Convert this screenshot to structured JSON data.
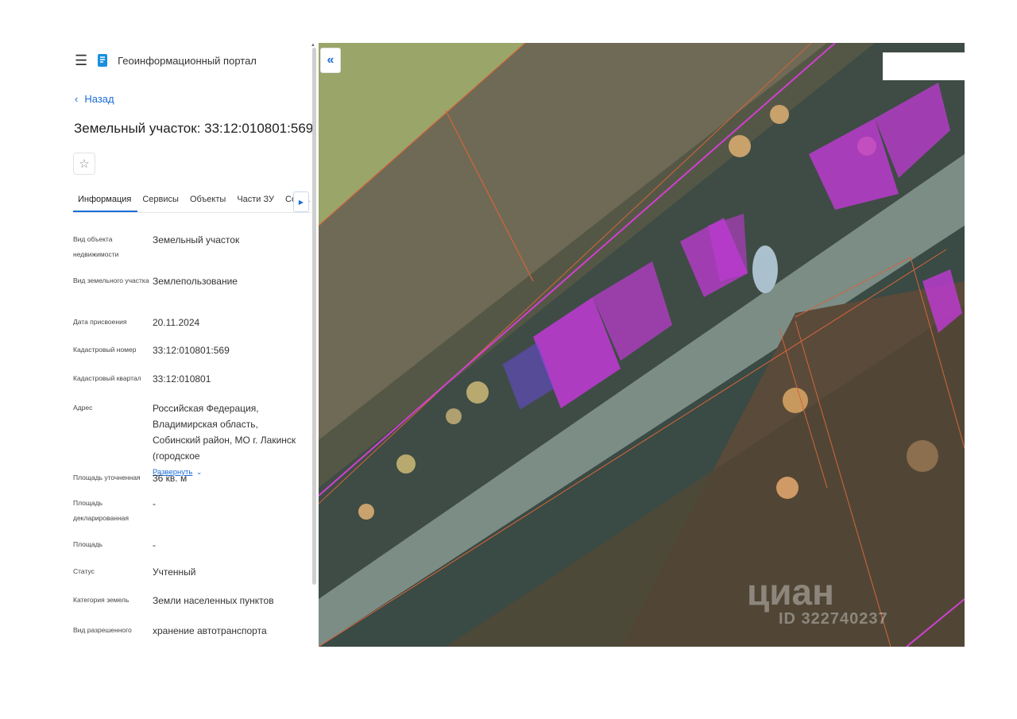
{
  "header": {
    "menu_icon": "hamburger-icon",
    "logo_icon": "portal-logo-icon",
    "title": "Геоинформационный портал"
  },
  "back_label": "Назад",
  "page_title": "Земельный участок: 33:12:010801:569",
  "tabs": [
    "Информация",
    "Сервисы",
    "Объекты",
    "Части ЗУ",
    "Соста"
  ],
  "fields": [
    {
      "label": "Вид объекта недвижимости",
      "value": "Земельный участок"
    },
    {
      "label": "Вид земельного участка",
      "value": "Землепользование"
    },
    {
      "label": "Дата присвоения",
      "value": "20.11.2024"
    },
    {
      "label": "Кадастровый номер",
      "value": "33:12:010801:569"
    },
    {
      "label": "Кадастровый квартал",
      "value": "33:12:010801"
    },
    {
      "label": "Адрес",
      "value": "Российская Федерация, Владимирская область, Собинский район, МО г. Лакинск (городское",
      "expand": "Развернуть"
    },
    {
      "label": "Площадь уточненная",
      "value": "36 кв. м"
    },
    {
      "label": "Площадь декларированная",
      "value": "-"
    },
    {
      "label": "Площадь",
      "value": "-"
    },
    {
      "label": "Статус",
      "value": "Учтенный"
    },
    {
      "label": "Категория земель",
      "value": "Земли населенных пунктов"
    },
    {
      "label": "Вид разрешенного",
      "value": "хранение автотранспорта"
    }
  ],
  "map": {
    "collapse_symbol": "«",
    "watermark_logo": "циан",
    "watermark_id": "ID 322740237"
  },
  "colors": {
    "accent": "#1a6dd8",
    "parcel_fill": "#c23ad6",
    "selected_parcel": "#6a4bd9",
    "boundary": "#d4653a"
  }
}
